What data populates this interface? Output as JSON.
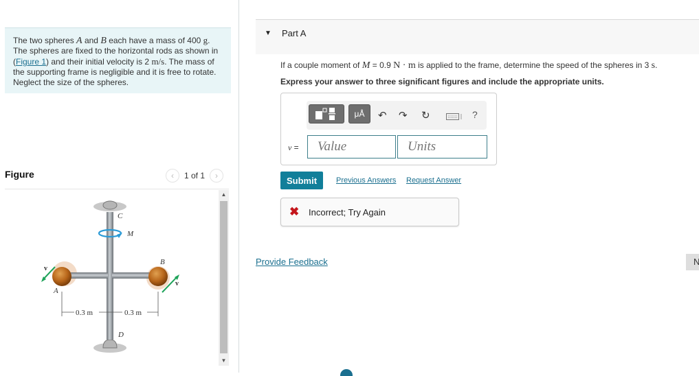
{
  "intro": {
    "text_1": "The two spheres ",
    "sphere_a": "A",
    "text_2": " and ",
    "sphere_b": "B",
    "text_3": " each have a mass of 400 ",
    "mass_unit": "g",
    "text_4": ". The spheres are fixed to the horizontal rods as shown in (",
    "figure_link": "Figure 1",
    "text_5": ") and their initial velocity is 2 ",
    "velocity_unit": "m/s",
    "text_6": ". The mass of the supporting frame is negligible and it is free to rotate. Neglect the size of the spheres."
  },
  "figure_panel": {
    "title": "Figure",
    "pager_text": "1 of 1",
    "prev_icon": "chevron-left-icon",
    "next_icon": "chevron-right-icon",
    "labels": {
      "C": "C",
      "M": "M",
      "B": "B",
      "A": "A",
      "D": "D",
      "v_left": "v",
      "v_right": "v",
      "dim_left": "0.3 m",
      "dim_right": "0.3 m"
    },
    "colors": {
      "sphere": "#b8661a",
      "rod": "#8a9096",
      "velocity_arrow": "#1fa35a",
      "moment_arrow": "#2a9ad6"
    }
  },
  "part_a": {
    "caret": "▼",
    "title": "Part A",
    "question_1": "If a couple moment of ",
    "question_var": "M",
    "question_2": " = 0.9 ",
    "question_unit": "N · m",
    "question_3": " is applied to the frame, determine the speed of the spheres in 3 ",
    "question_time_unit": "s",
    "question_4": ".",
    "instruction": "Express your answer to three significant figures and include the appropriate units."
  },
  "answer": {
    "toolbar": {
      "templates_icon": "templates-icon",
      "units_button": "μÅ",
      "undo_icon": "↶",
      "redo_icon": "↷",
      "reset_icon": "↻",
      "keyboard_icon": "keyboard-icon",
      "help": "?"
    },
    "variable": "v",
    "equals": " =",
    "value_placeholder": "Value",
    "units_placeholder": "Units"
  },
  "actions": {
    "submit": "Submit",
    "previous_answers": "Previous Answers",
    "request_answer": "Request Answer"
  },
  "feedback": {
    "icon": "✖",
    "message": "Incorrect; Try Again",
    "status_color": "#c4161c"
  },
  "footer": {
    "provide_feedback": "Provide Feedback",
    "next_button": "N"
  },
  "colors": {
    "accent": "#117f9a",
    "link": "#1a6f8f",
    "intro_bg": "#e8f5f7"
  }
}
